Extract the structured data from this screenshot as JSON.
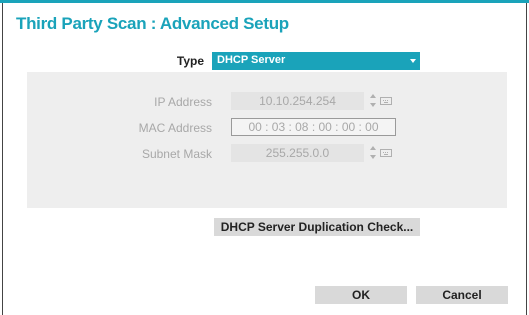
{
  "dialog": {
    "title": "Third Party Scan : Advanced Setup",
    "accent_color": "#1aa3ba"
  },
  "type": {
    "label": "Type",
    "selected": "DHCP Server",
    "icon": "chevron-down-icon"
  },
  "fields": {
    "ip": {
      "label": "IP Address",
      "value": "10.10.254.254",
      "icons": [
        "spinner-icon",
        "keyboard-icon"
      ]
    },
    "mac": {
      "label": "MAC Address",
      "value": "00 : 03 : 08 : 00 : 00 : 00"
    },
    "subnet": {
      "label": "Subnet Mask",
      "value": "255.255.0.0",
      "icons": [
        "spinner-icon",
        "keyboard-icon"
      ]
    }
  },
  "buttons": {
    "duplication_check": "DHCP Server Duplication Check...",
    "ok": "OK",
    "cancel": "Cancel"
  }
}
